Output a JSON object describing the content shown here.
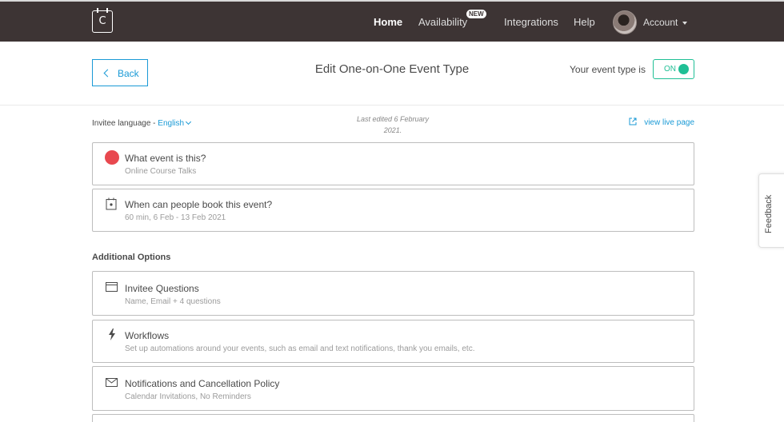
{
  "nav": {
    "logo_letter": "C",
    "home": "Home",
    "availability": "Availability",
    "new_badge": "NEW",
    "integrations": "Integrations",
    "help": "Help",
    "account": "Account"
  },
  "header": {
    "back_label": "Back",
    "title": "Edit One-on-One Event Type",
    "status_label": "Your event type is",
    "toggle_state": "ON"
  },
  "meta": {
    "invitee_language_label": "Invitee language - ",
    "invitee_language_value": "English",
    "last_edited_line1": "Last edited 6 February",
    "last_edited_line2": "2021.",
    "view_live_label": "view live page"
  },
  "cards": [
    {
      "title": "What event is this?",
      "subtitle": "Online Course Talks",
      "icon": "red-dot-icon"
    },
    {
      "title": "When can people book this event?",
      "subtitle": "60 min, 6 Feb - 13 Feb 2021",
      "icon": "calendar-icon"
    }
  ],
  "additional": {
    "heading": "Additional Options",
    "items": [
      {
        "title": "Invitee Questions",
        "subtitle": "Name, Email + 4 questions",
        "icon": "form-icon"
      },
      {
        "title": "Workflows",
        "subtitle": "Set up automations around your events, such as email and text notifications, thank you emails, etc.",
        "icon": "lightning-icon"
      },
      {
        "title": "Notifications and Cancellation Policy",
        "subtitle": "Calendar Invitations, No Reminders",
        "icon": "envelope-icon"
      }
    ]
  },
  "feedback_label": "Feedback",
  "colors": {
    "topbar": "#3d3434",
    "link": "#1a9ad6",
    "toggle_on": "#1fbf95",
    "event_dot": "#e8484f"
  }
}
